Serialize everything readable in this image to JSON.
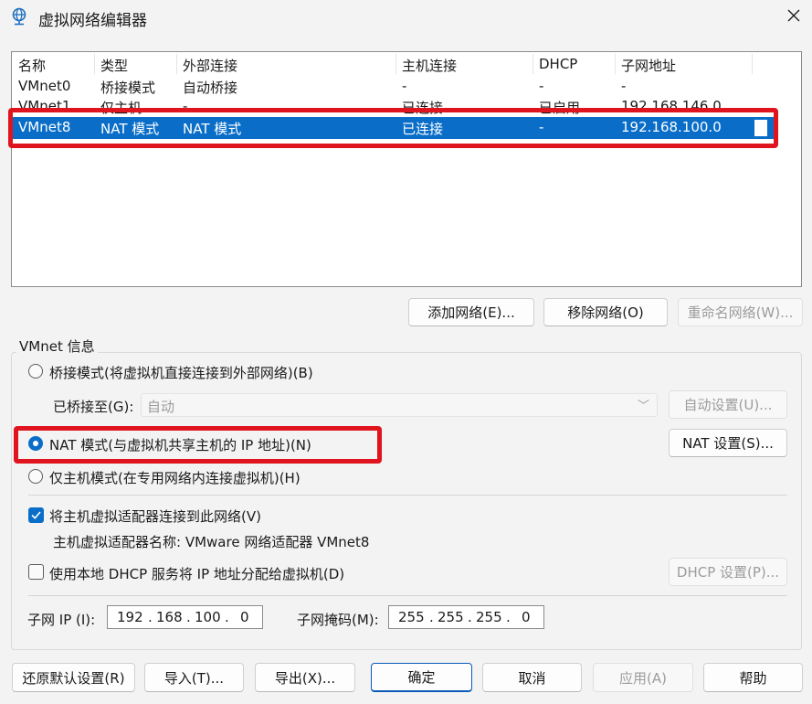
{
  "window": {
    "title": "虚拟网络编辑器",
    "close": "✕"
  },
  "list": {
    "columns": [
      "名称",
      "类型",
      "外部连接",
      "主机连接",
      "DHCP",
      "子网地址"
    ],
    "rows": [
      [
        "VMnet0",
        "桥接模式",
        "自动桥接",
        "-",
        "-",
        "-"
      ],
      [
        "VMnet1",
        "仅主机",
        "-",
        "已连接",
        "已启用",
        "192.168.146.0"
      ],
      [
        "VMnet8",
        "NAT 模式",
        "NAT 模式",
        "已连接",
        "-",
        "192.168.100.0"
      ]
    ]
  },
  "list_buttons": {
    "add": "添加网络(E)...",
    "remove": "移除网络(O)",
    "rename": "重命名网络(W)..."
  },
  "info": {
    "group_label": "VMnet 信息",
    "bridge_mode": "桥接模式(将虚拟机直接连接到外部网络)(B)",
    "bridged_to_label": "已桥接至(G):",
    "bridged_to_value": "自动",
    "auto_settings": "自动设置(U)...",
    "nat_mode": "NAT 模式(与虚拟机共享主机的 IP 地址)(N)",
    "nat_settings": "NAT 设置(S)...",
    "host_only_mode": "仅主机模式(在专用网络内连接虚拟机)(H)",
    "connect_adapter": "将主机虚拟适配器连接到此网络(V)",
    "adapter_name": "主机虚拟适配器名称: VMware 网络适配器 VMnet8",
    "use_dhcp": "使用本地 DHCP 服务将 IP 地址分配给虚拟机(D)",
    "dhcp_settings": "DHCP 设置(P)...",
    "subnet_ip_label": "子网 IP (I):",
    "subnet_ip": [
      "192",
      "168",
      "100",
      "0"
    ],
    "subnet_mask_label": "子网掩码(M):",
    "subnet_mask": [
      "255",
      "255",
      "255",
      "0"
    ]
  },
  "footer": {
    "restore": "还原默认设置(R)",
    "import": "导入(T)...",
    "export": "导出(X)...",
    "ok": "确定",
    "cancel": "取消",
    "apply": "应用(A)",
    "help": "帮助"
  },
  "colors": {
    "selection": "#0a6ec9",
    "highlight_box": "#e0141e"
  }
}
